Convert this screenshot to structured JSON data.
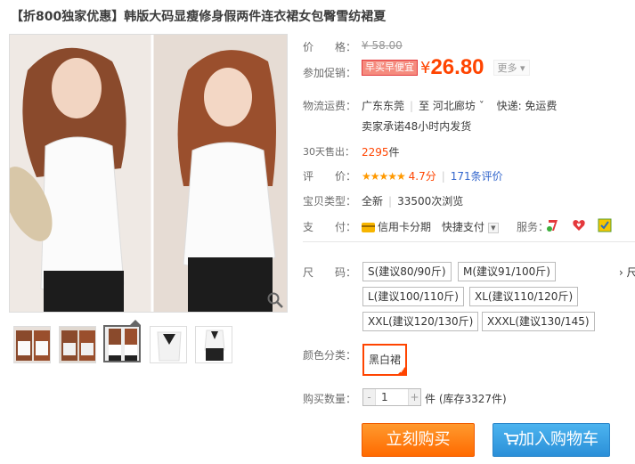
{
  "product": {
    "title": "【折800独家优惠】韩版大码显瘦修身假两件连衣裙女包臀雪纺裙夏"
  },
  "gallery": {
    "zoom_icon": "magnifier-icon",
    "thumbnail_count": 5,
    "active_thumbnail": 3
  },
  "price": {
    "label": "价　　格：",
    "original": "¥ 58.00"
  },
  "promotion": {
    "label": "参加促销：",
    "tag": "早买早便宜",
    "currency": "¥",
    "value": "26.80",
    "more": "更多 ▾"
  },
  "shipping": {
    "label": "物流运费：",
    "from": "广东东莞",
    "to_prefix": "至",
    "to": "河北廊坊 ˇ",
    "method": "快递: 免运费",
    "promise": "卖家承诺48小时内发货"
  },
  "sales": {
    "label": "30天售出：",
    "count": "2295",
    "unit": "件"
  },
  "rating": {
    "label": "评　　价：",
    "stars": "★★★★★",
    "score": "4.7分",
    "reviews": "171条评价"
  },
  "condition": {
    "label": "宝贝类型：",
    "value": "全新",
    "views": "33500次浏览"
  },
  "payment": {
    "label": "支　　付：",
    "installment": "信用卡分期",
    "quick": "快捷支付",
    "services_label": "服务："
  },
  "size": {
    "label": "尺　　码：",
    "options": [
      "S(建议80/90斤)",
      "M(建议91/100斤)",
      "L(建议100/110斤)",
      "XL(建议110/120斤)",
      "XXL(建议120/130斤)",
      "XXXL(建议130/145)"
    ],
    "more": "› 尺"
  },
  "color": {
    "label": "颜色分类：",
    "selected": "黑白裙"
  },
  "quantity": {
    "label": "购买数量：",
    "value": "1",
    "minus": "-",
    "plus": "+",
    "stock": "件 (库存3327件)"
  },
  "actions": {
    "buy": "立刻购买",
    "cart": "加入购物车"
  },
  "colors": {
    "accent": "#ff4400",
    "buy_button": "#ff7a1a",
    "cart_button": "#3aa3e6",
    "star": "#ff9900"
  }
}
